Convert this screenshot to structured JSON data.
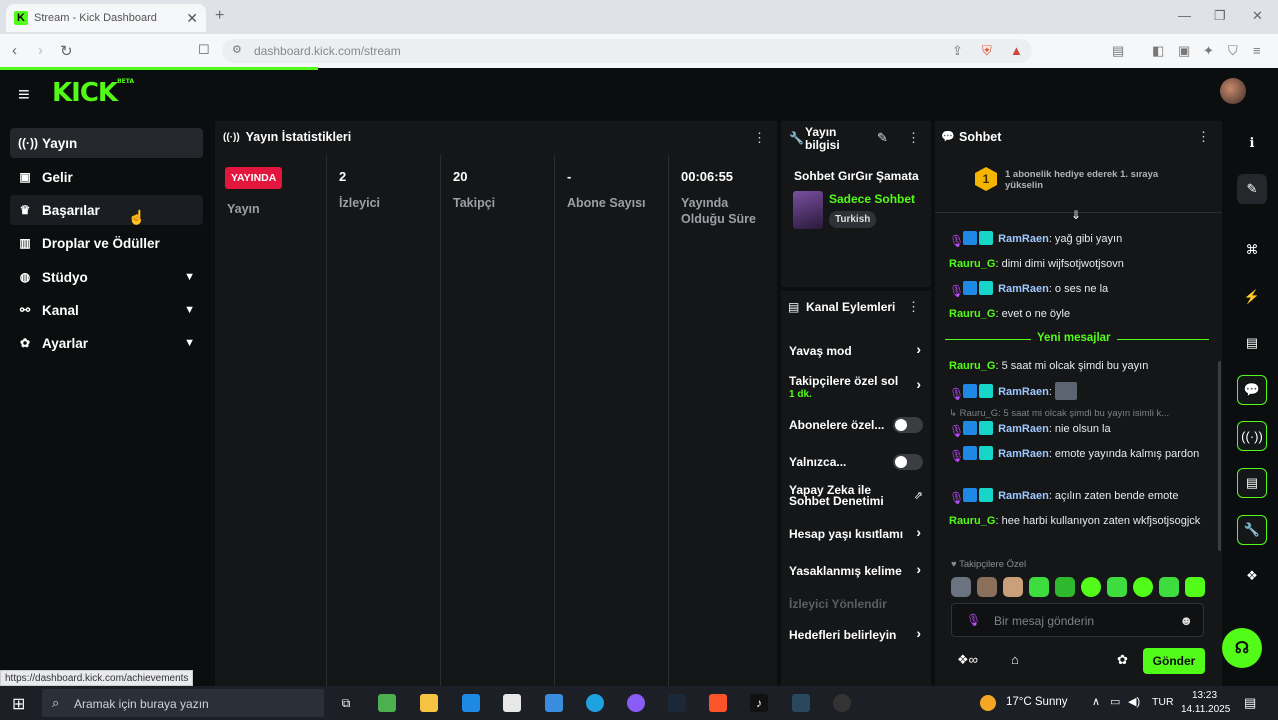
{
  "browser": {
    "tab_title": "Stream - Kick Dashboard",
    "new_tab": "+",
    "url": "dashboard.kick.com/stream",
    "status_url": "https://dashboard.kick.com/achievements"
  },
  "app": {
    "logo": "KICK",
    "logo_sup": "BETA"
  },
  "sidebar": {
    "items": [
      {
        "label": "Yayın",
        "icon": "broadcast-icon"
      },
      {
        "label": "Gelir",
        "icon": "revenue-icon"
      },
      {
        "label": "Başarılar",
        "icon": "trophy-icon"
      },
      {
        "label": "Droplar ve Ödüller",
        "icon": "gift-icon"
      },
      {
        "label": "Stüdyo",
        "icon": "studio-icon"
      },
      {
        "label": "Kanal",
        "icon": "channel-icon"
      },
      {
        "label": "Ayarlar",
        "icon": "gear-icon"
      }
    ]
  },
  "stats": {
    "title": "Yayın İstatistikleri",
    "live_badge": "YAYINDA",
    "live_label": "Yayın",
    "viewers_value": "2",
    "viewers_label": "İzleyici",
    "followers_value": "20",
    "followers_label": "Takipçi",
    "subs_value": "-",
    "subs_label": "Abone Sayısı",
    "uptime_value": "00:06:55",
    "uptime_label_1": "Yayında",
    "uptime_label_2": "Olduğu Süre"
  },
  "stream_info": {
    "title_1": "Yayın",
    "title_2": "bilgisi",
    "stream_title": "Sohbet GırGır Şamata",
    "category": "Sadece Sohbet",
    "language": "Turkish"
  },
  "channel_actions": {
    "title": "Kanal Eylemleri",
    "slow_mode": "Yavaş mod",
    "followers_only_1": "Takipçilere özel sol",
    "followers_only_2": "1 dk.",
    "subs_only": "Abonelere özel...",
    "emotes_only": "Yalnızca...",
    "ai_mod_1": "Yapay Zeka ile",
    "ai_mod_2": "Sohbet Denetimi",
    "account_age": "Hesap yaşı kısıtlamı",
    "banned_words": "Yasaklanmış kelime",
    "viewer_redirect": "İzleyici Yönlendir",
    "set_goals": "Hedefleri belirleyin"
  },
  "chat": {
    "title": "Sohbet",
    "gift_rank": "1",
    "gift_text": "1 abonelik hediye ederek 1. sıraya yükselin",
    "new_messages": "Yeni mesajlar",
    "messages": [
      {
        "user": "RamRaen",
        "text": ": yağ gibi yayın",
        "badges": true
      },
      {
        "user": "Rauru_G",
        "text": ": dimi dimi wijfsotjwotjsovn",
        "badges": false
      },
      {
        "user": "RamRaen",
        "text": ": o ses ne la",
        "badges": true
      },
      {
        "user": "Rauru_G",
        "text": ": evet o ne öyle",
        "badges": false
      },
      {
        "user": "Rauru_G",
        "text": ": 5 saat mi olcak şimdi bu yayın",
        "badges": false
      },
      {
        "user": "RamRaen",
        "text": ":",
        "badges": true
      },
      {
        "user": "RamRaen",
        "text": ": nie olsun la",
        "badges": true
      },
      {
        "user": "RamRaen",
        "text": ": emote yayında kalmış pardon",
        "badges": true
      },
      {
        "user": "RamRaen",
        "text": ": açılın zaten bende emote",
        "badges": true
      },
      {
        "user": "Rauru_G",
        "text": ": hee harbi kullanıyon zaten wkfjsotjsogjck",
        "badges": false
      }
    ],
    "reply_preview": "↳ Rauru_G: 5 saat mi olcak şimdi bu yayın isimli k...",
    "followers_only_label": "♥ Takipçilere Özel",
    "input_placeholder": "Bir mesaj gönderin",
    "send_label": "Gönder"
  },
  "taskbar": {
    "search_placeholder": "Aramak için buraya yazın",
    "weather": "17°C  Sunny",
    "lang": "TUR",
    "time": "13:23",
    "date": "14.11.2025"
  },
  "colors": {
    "accent": "#53fc18",
    "live": "#e3173e",
    "background": "#0b0e0f",
    "panel": "#141618"
  }
}
